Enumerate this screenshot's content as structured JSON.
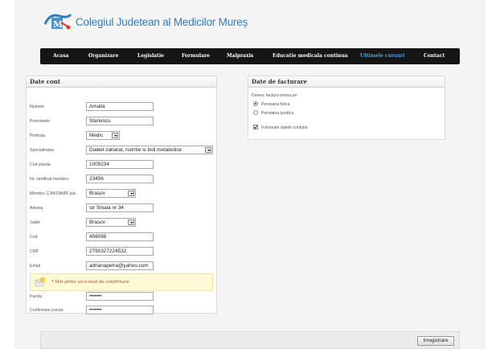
{
  "brand": {
    "title": "Colegiul Judetean al Medicilor Mureș"
  },
  "nav": [
    "Acasa",
    "Organizare",
    "Legislatie",
    "Formulare",
    "Malpraxis",
    "Educatie medicala continua",
    "Ultimele cursuri",
    "Contact"
  ],
  "nav_active": "Ultimele cursuri",
  "account": {
    "heading": "Date cont",
    "fields": {
      "nume": {
        "label": "Numele",
        "value": "Amalia"
      },
      "prenume": {
        "label": "Prenumele",
        "value": "Stanescu"
      },
      "profesia": {
        "label": "Profesia",
        "value": "Medic"
      },
      "specialitatea": {
        "label": "Specialitatea",
        "value": "Diabet zaharat, nutritie si boli metabolice"
      },
      "cod_parafa": {
        "label": "Cod parafa",
        "value": "1009234"
      },
      "certificat": {
        "label": "Nr. certificat membru",
        "value": "23456"
      },
      "membru": {
        "label": "Membru CJM/OAMR jud.",
        "value": "Brașov"
      },
      "adresa": {
        "label": "Adresa",
        "value": "str Sinaia nr 34"
      },
      "judet": {
        "label": "Judet",
        "value": "Brașov"
      },
      "cod": {
        "label": "Cod",
        "value": "456098"
      },
      "cnp": {
        "label": "CNP",
        "value": "2790327224532"
      },
      "email": {
        "label": "Email",
        "value": "adrianapetra@yahoo.com"
      },
      "parola": {
        "label": "Parola",
        "value": "•••••••"
      },
      "confirmare": {
        "label": "Confirmare parola",
        "value": "•••••••"
      }
    },
    "notice": "* Veti primi un e-mail de confirmare"
  },
  "billing": {
    "heading": "Date de facturare",
    "question": "Doresc factura emisa pe",
    "option_fizica": "Persoana fizica",
    "option_juridica": "Persoana juridica",
    "selected": "Persoana fizica",
    "use_account_data": "Foloseste datele contului",
    "use_account_checked": true
  },
  "submit_label": "Inregistrare"
}
